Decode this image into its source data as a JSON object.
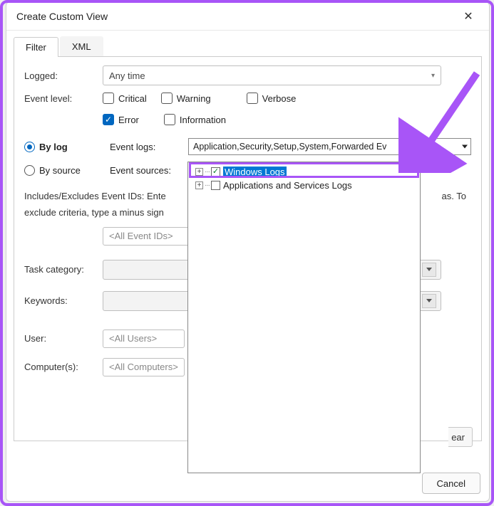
{
  "dialog": {
    "title": "Create Custom View"
  },
  "tabs": {
    "filter": "Filter",
    "xml": "XML",
    "active": "filter"
  },
  "filter": {
    "logged_label": "Logged:",
    "logged_value": "Any time",
    "event_level_label": "Event level:",
    "levels": {
      "critical": "Critical",
      "warning": "Warning",
      "verbose": "Verbose",
      "error": "Error",
      "information": "Information"
    },
    "by_log": "By log",
    "by_source": "By source",
    "event_logs_label": "Event logs:",
    "event_logs_value": "Application,Security,Setup,System,Forwarded Ev",
    "event_sources_label": "Event sources:",
    "tree": {
      "windows_logs": "Windows Logs",
      "apps_services": "Applications and Services Logs"
    },
    "ids_text_left": "Includes/Excludes Event IDs: Ente",
    "ids_text_right": "as. To",
    "ids_text_line2": "exclude criteria, type a minus sign",
    "ids_placeholder": "<All Event IDs>",
    "task_category_label": "Task category:",
    "keywords_label": "Keywords:",
    "user_label": "User:",
    "user_placeholder": "<All Users>",
    "computers_label": "Computer(s):",
    "computers_placeholder": "<All Computers>",
    "clear_fragment": "ear"
  },
  "footer": {
    "cancel": "Cancel"
  }
}
